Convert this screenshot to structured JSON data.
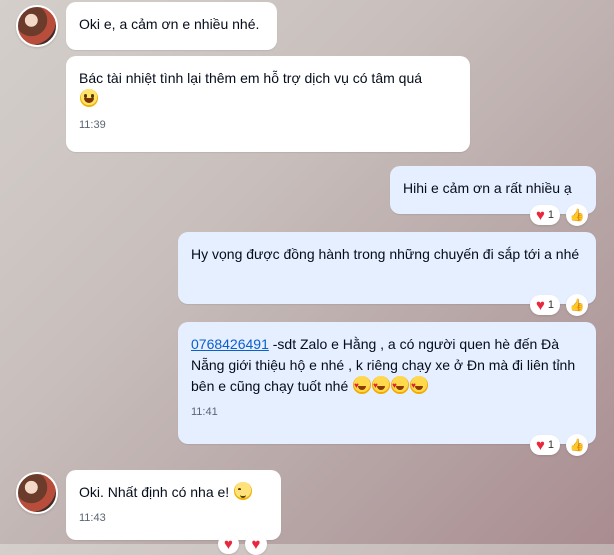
{
  "messages": [
    {
      "from": "in",
      "text": "Oki e, a cảm ơn e nhiều nhé."
    },
    {
      "from": "in",
      "text": "Bác tài nhiệt tình lại thêm em hỗ trợ dịch vụ có tâm quá",
      "emoji": "smile-emoji",
      "time": "11:39"
    },
    {
      "from": "out",
      "text": "Hihi e cảm ơn a rất nhiều ạ",
      "reaction_count": "1"
    },
    {
      "from": "out",
      "text": "Hy vọng được đồng hành trong những chuyến đi sắp tới a nhé",
      "reaction_count": "1"
    },
    {
      "from": "out",
      "phone": "0768426491",
      "text": " -sdt Zalo e Hằng , a có người quen hè đến Đà Nẵng giới thiệu hộ e nhé , k riêng chạy xe ở Đn mà đi liên tỉnh bên e cũng chạy tuốt nhé",
      "emoji": "heart-eyes-emoji",
      "time": "11:41",
      "reaction_count": "1"
    },
    {
      "from": "in",
      "text": "Oki. Nhất định có nha e!",
      "emoji": "blush-emoji",
      "time": "11:43"
    }
  ],
  "colors": {
    "incoming": "#ffffff",
    "outgoing": "#e5efff",
    "heart": "#e8283d",
    "link": "#0b5fcc"
  }
}
